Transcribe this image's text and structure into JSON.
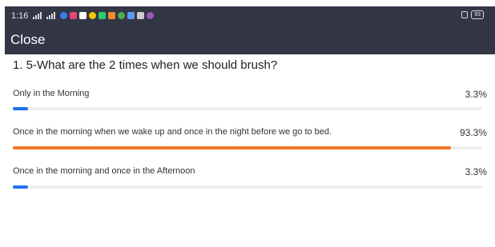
{
  "status_bar": {
    "time": "1:16",
    "battery": "93",
    "notification_colors": [
      "#3d7bf0",
      "#e0457b",
      "#ffffff",
      "#f7c600",
      "#2ecc71",
      "#f28c28",
      "#4caf50",
      "#5a9cf5",
      "#cccccc",
      "#9b59b6"
    ]
  },
  "header": {
    "close_label": "Close"
  },
  "question": {
    "title": "1. 5-What are the 2 times when we should brush?"
  },
  "options": [
    {
      "label": "Only in the Morning",
      "percent_text": "3.3%",
      "percent": 3.3,
      "color": "#1e73e8"
    },
    {
      "label": "Once in the morning when we wake up and once in the night before we go to bed.",
      "percent_text": "93.3%",
      "percent": 93.3,
      "color": "#f0782c"
    },
    {
      "label": "Once in the morning and once in the Afternoon",
      "percent_text": "3.3%",
      "percent": 3.3,
      "color": "#1e73e8"
    }
  ]
}
